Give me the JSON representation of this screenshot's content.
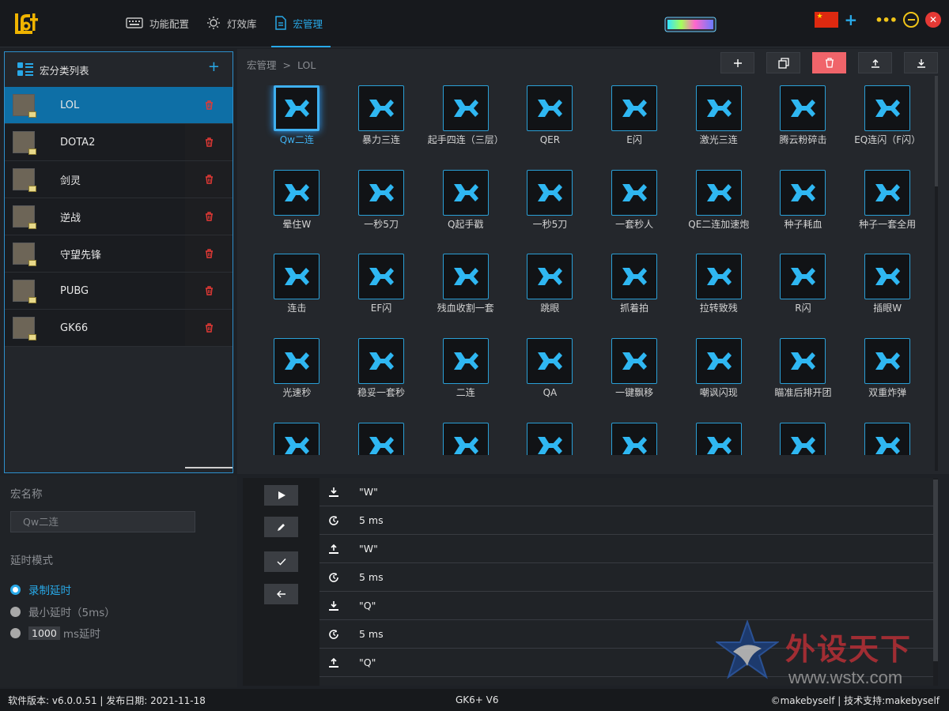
{
  "app": {
    "nav": [
      {
        "label": "功能配置",
        "icon": "keyboard-icon"
      },
      {
        "label": "灯效库",
        "icon": "light-icon"
      },
      {
        "label": "宏管理",
        "icon": "document-icon",
        "active": true
      }
    ],
    "accent": "#28a9e8",
    "flag_glyph": "★"
  },
  "category_panel": {
    "title": "宏分类列表",
    "add_glyph": "+",
    "items": [
      {
        "label": "LOL",
        "active": true
      },
      {
        "label": "DOTA2"
      },
      {
        "label": "剑灵"
      },
      {
        "label": "逆战"
      },
      {
        "label": "守望先锋"
      },
      {
        "label": "PUBG"
      },
      {
        "label": "GK66"
      }
    ]
  },
  "breadcrumb": {
    "root": "宏管理",
    "sep": ">",
    "current": "LOL"
  },
  "toolbar": [
    {
      "name": "add-macro-button",
      "glyph": "+"
    },
    {
      "name": "copy-macro-button",
      "glyph": "copy"
    },
    {
      "name": "delete-macro-button",
      "glyph": "trash"
    },
    {
      "name": "export-button",
      "glyph": "upload"
    },
    {
      "name": "import-button",
      "glyph": "download"
    }
  ],
  "macros": [
    "Qw二连",
    "暴力三连",
    "起手四连（三层）",
    "QER",
    "E闪",
    "激光三连",
    "腾云粉碎击",
    "EQ连闪（F闪）",
    "晕住W",
    "一秒5刀",
    "Q起手戳",
    "一秒5刀",
    "一套秒人",
    "QE二连加速炮",
    "种子耗血",
    "种子一套全用",
    "连击",
    "EF闪",
    "残血收割一套",
    "跳眼",
    "抓着拍",
    "拉转致残",
    "R闪",
    "插眼W",
    "光速秒",
    "稳妥一套秒",
    "二连",
    "QA",
    "一键飘移",
    "嘲讽闪现",
    "瞄准后排开团",
    "双重炸弹",
    "",
    "",
    "",
    "",
    "",
    "",
    "",
    ""
  ],
  "selected_macro": 0,
  "editor": {
    "name_label": "宏名称",
    "name_value": "Qw二连",
    "delay_label": "延时模式",
    "options": [
      {
        "label": "录制延时",
        "selected": true
      },
      {
        "label": "最小延时（5ms）",
        "selected": false
      },
      {
        "label": "ms延时",
        "value": "1000",
        "selected": false
      }
    ]
  },
  "steps": [
    {
      "type": "press",
      "text": "\"W\""
    },
    {
      "type": "delay",
      "text": "5 ms"
    },
    {
      "type": "release",
      "text": "\"W\""
    },
    {
      "type": "delay",
      "text": "5 ms"
    },
    {
      "type": "press",
      "text": "\"Q\""
    },
    {
      "type": "delay",
      "text": "5 ms"
    },
    {
      "type": "release",
      "text": "\"Q\""
    }
  ],
  "watermark": {
    "text": "外设天下",
    "url": "www.wstx.com"
  },
  "status": {
    "left": "软件版本: v6.0.0.51 | 发布日期: 2021-11-18",
    "center": "GK6+ V6",
    "right": "©makebyself | 技术支持:makebyself"
  }
}
